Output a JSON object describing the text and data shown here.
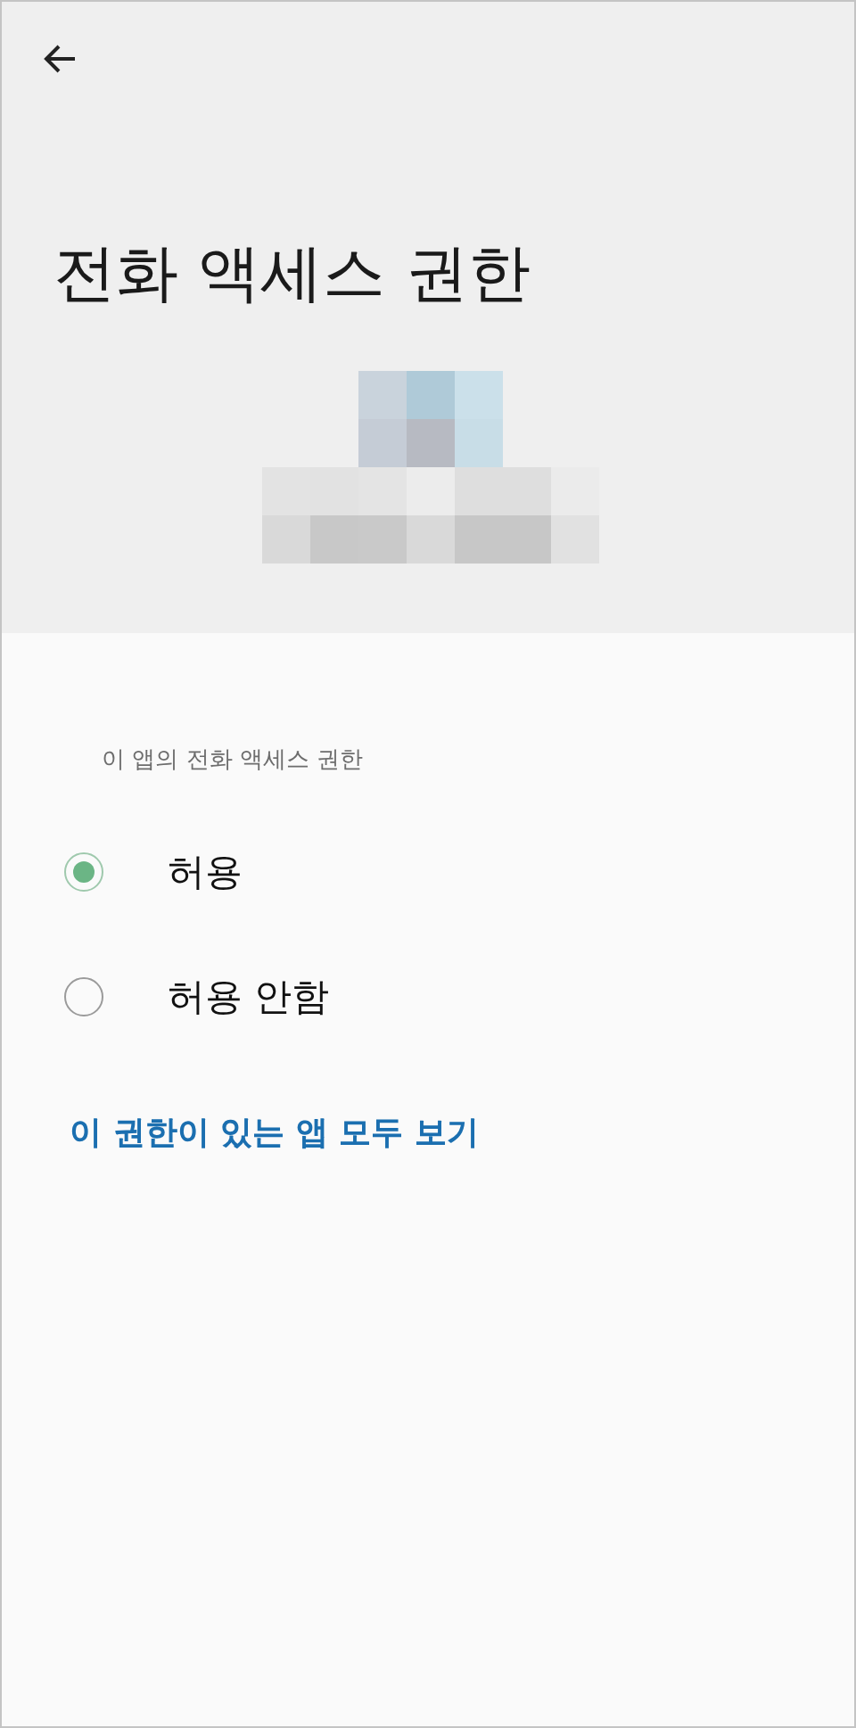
{
  "header": {
    "back": {
      "kind": "back"
    },
    "title": "전화 액세스 권한"
  },
  "section_label": "이 앱의 전화 액세스 권한",
  "options": [
    {
      "label": "허용",
      "selected": true
    },
    {
      "label": "허용 안함",
      "selected": false
    }
  ],
  "link": "이 권한이 있는 앱 모두 보기"
}
